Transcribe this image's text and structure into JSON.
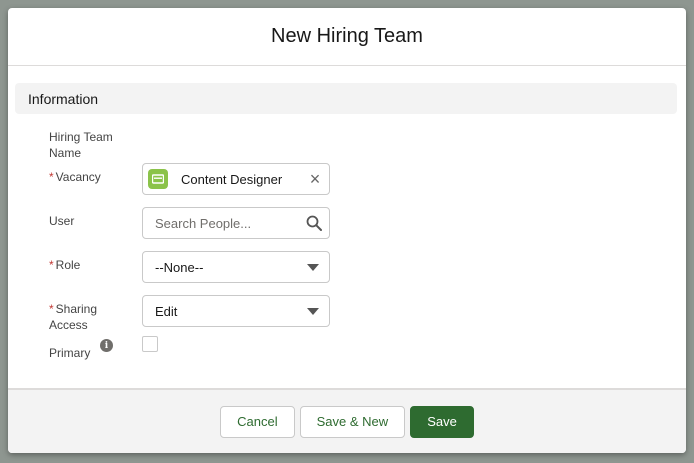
{
  "modal": {
    "title": "New Hiring Team"
  },
  "section": {
    "title": "Information"
  },
  "fields": {
    "hiring_team_name": {
      "label": "Hiring Team Name"
    },
    "vacancy": {
      "label": "Vacancy",
      "required_mark": "*",
      "value": "Content Designer",
      "icon": "job-icon",
      "icon_color": "#8bc34a"
    },
    "user": {
      "label": "User",
      "placeholder": "Search People..."
    },
    "role": {
      "label": "Role",
      "required_mark": "*",
      "value": "--None--"
    },
    "sharing_access": {
      "label": "Sharing Access",
      "required_mark": "*",
      "value": "Edit"
    },
    "primary": {
      "label": "Primary",
      "checked": false
    }
  },
  "footer": {
    "cancel_label": "Cancel",
    "save_new_label": "Save & New",
    "save_label": "Save"
  },
  "colors": {
    "brand": "#2e6b30",
    "required": "#c23934"
  }
}
